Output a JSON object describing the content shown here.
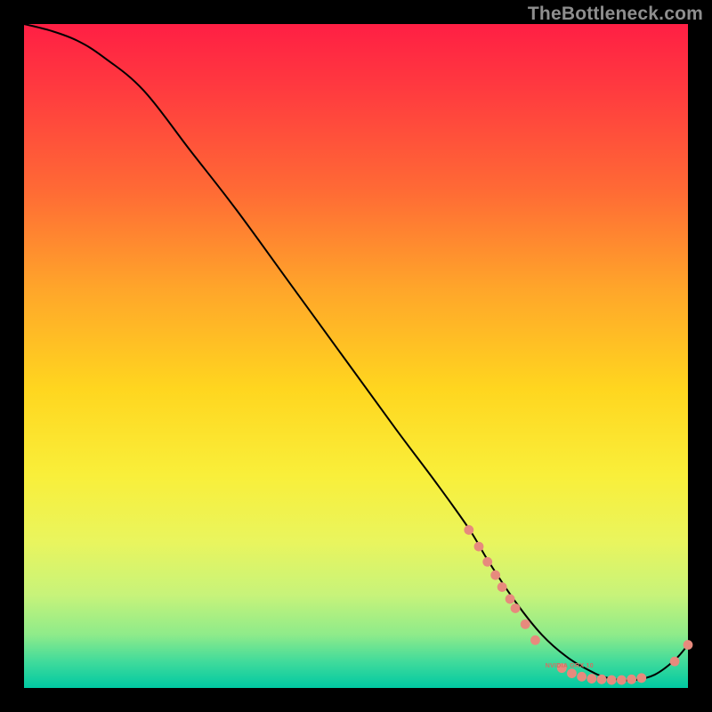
{
  "watermark": "TheBottleneck.com",
  "annotation": {
    "label": "NVIDIA GRX 10"
  },
  "colors": {
    "curve_stroke": "#000000",
    "marker_fill": "#e78a7d",
    "marker_stroke": "#c96a5d"
  },
  "chart_data": {
    "type": "line",
    "title": "",
    "xlabel": "",
    "ylabel": "",
    "xlim": [
      0,
      100
    ],
    "ylim": [
      0,
      100
    ],
    "grid": false,
    "series": [
      {
        "name": "bottleneck-curve",
        "x": [
          0,
          4,
          8,
          12,
          18,
          25,
          32,
          40,
          48,
          56,
          62,
          67,
          70,
          74,
          78,
          82,
          86,
          88,
          90,
          92,
          95,
          98,
          100
        ],
        "y": [
          100,
          99,
          97.5,
          95,
          90,
          81,
          72,
          61,
          50,
          39,
          31,
          24,
          19,
          13,
          8,
          4.5,
          2.2,
          1.5,
          1.2,
          1.2,
          2.0,
          4.2,
          6.5
        ]
      }
    ],
    "markers": [
      {
        "x": 67.0,
        "y": 23.8
      },
      {
        "x": 68.5,
        "y": 21.3
      },
      {
        "x": 69.8,
        "y": 19.0
      },
      {
        "x": 71.0,
        "y": 17.0
      },
      {
        "x": 72.0,
        "y": 15.2
      },
      {
        "x": 73.2,
        "y": 13.4
      },
      {
        "x": 74.0,
        "y": 12.0
      },
      {
        "x": 75.5,
        "y": 9.6
      },
      {
        "x": 77.0,
        "y": 7.2
      },
      {
        "x": 81.0,
        "y": 3.0
      },
      {
        "x": 82.5,
        "y": 2.2
      },
      {
        "x": 84.0,
        "y": 1.7
      },
      {
        "x": 85.5,
        "y": 1.4
      },
      {
        "x": 87.0,
        "y": 1.3
      },
      {
        "x": 88.5,
        "y": 1.2
      },
      {
        "x": 90.0,
        "y": 1.2
      },
      {
        "x": 91.5,
        "y": 1.3
      },
      {
        "x": 93.0,
        "y": 1.5
      },
      {
        "x": 98.0,
        "y": 4.0
      },
      {
        "x": 100.0,
        "y": 6.5
      }
    ],
    "annotation_anchor": {
      "x": 82,
      "y": 3.2
    }
  }
}
